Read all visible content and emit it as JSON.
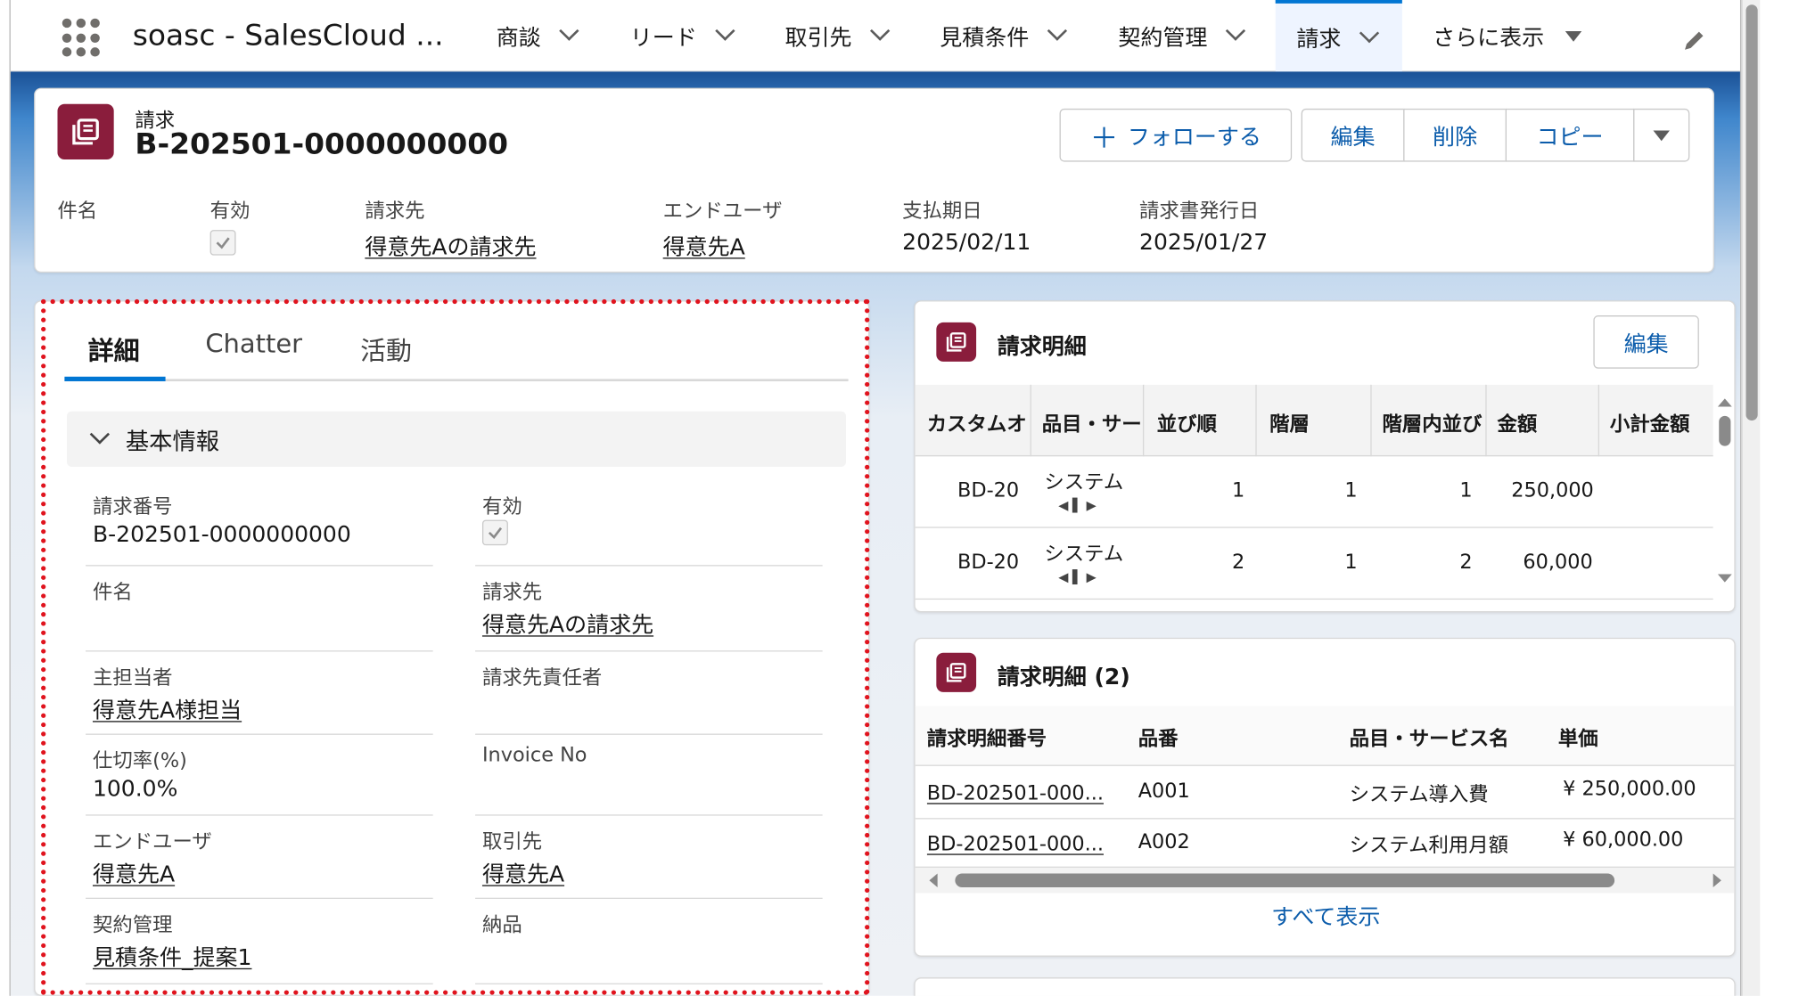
{
  "app": {
    "name": "soasc - SalesCloud ..."
  },
  "nav": {
    "items": [
      {
        "label": "商談"
      },
      {
        "label": "リード"
      },
      {
        "label": "取引先"
      },
      {
        "label": "見積条件"
      },
      {
        "label": "契約管理"
      },
      {
        "label": "請求"
      },
      {
        "label": "さらに表示"
      }
    ],
    "active_index": 5
  },
  "record": {
    "object_label": "請求",
    "title": "B-202501-0000000000",
    "actions": {
      "follow": "フォローする",
      "edit": "編集",
      "delete": "削除",
      "copy": "コピー"
    },
    "highlights": [
      {
        "label": "件名",
        "value": ""
      },
      {
        "label": "有効",
        "checked": true
      },
      {
        "label": "請求先",
        "value": "得意先Aの請求先"
      },
      {
        "label": "エンドユーザ",
        "value": "得意先A"
      },
      {
        "label": "支払期日",
        "value": "2025/02/11"
      },
      {
        "label": "請求書発行日",
        "value": "2025/01/27"
      }
    ]
  },
  "detail": {
    "tabs": [
      {
        "label": "詳細"
      },
      {
        "label": "Chatter"
      },
      {
        "label": "活動"
      }
    ],
    "section_title": "基本情報",
    "fields": [
      {
        "label": "請求番号",
        "value": "B-202501-0000000000"
      },
      {
        "label": "有効",
        "checked": true
      },
      {
        "label": "件名",
        "value": ""
      },
      {
        "label": "請求先",
        "value": "得意先Aの請求先"
      },
      {
        "label": "主担当者",
        "value": "得意先A様担当"
      },
      {
        "label": "請求先責任者",
        "value": ""
      },
      {
        "label": "仕切率(%)",
        "value": "100.0%"
      },
      {
        "label": "Invoice No",
        "value": ""
      },
      {
        "label": "エンドユーザ",
        "value": "得意先A"
      },
      {
        "label": "取引先",
        "value": "得意先A"
      },
      {
        "label": "契約管理",
        "value": "見積条件_提案1"
      },
      {
        "label": "納品",
        "value": ""
      }
    ]
  },
  "lines_card": {
    "title": "請求明細",
    "edit_label": "編集",
    "columns": [
      "カスタムオ",
      "品目・サー",
      "並び順",
      "階層",
      "階層内並び",
      "金額",
      "小計金額"
    ],
    "rows": [
      {
        "custom": "BD-20",
        "item": "システム",
        "order": "1",
        "level": "1",
        "level_order": "1",
        "amount": "250,000",
        "subtotal": ""
      },
      {
        "custom": "BD-20",
        "item": "システム",
        "order": "2",
        "level": "1",
        "level_order": "2",
        "amount": "60,000",
        "subtotal": ""
      }
    ]
  },
  "lines_related": {
    "title": "請求明細 (2)",
    "columns": [
      "請求明細番号",
      "品番",
      "品目・サービス名",
      "単価"
    ],
    "rows": [
      {
        "number": "BD-202501-000...",
        "code": "A001",
        "name": "システム導入費",
        "price": "¥ 250,000.00"
      },
      {
        "number": "BD-202501-000...",
        "code": "A002",
        "name": "システム利用月額",
        "price": "¥ 60,000.00"
      }
    ],
    "view_all": "すべて表示"
  },
  "colors": {
    "brand": "#0176d3",
    "object_icon": "#8a1d3c",
    "highlight_box": "#e0141e"
  }
}
